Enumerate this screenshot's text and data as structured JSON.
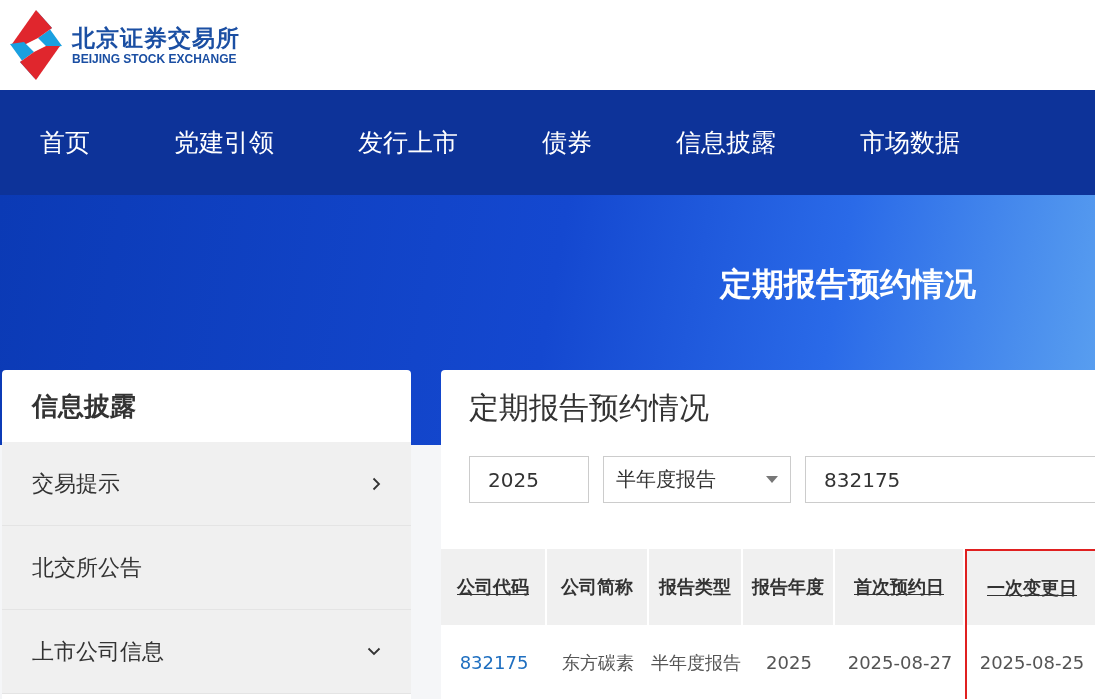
{
  "logo": {
    "name": "北京证券交易所",
    "name_en": "BEIJING STOCK EXCHANGE"
  },
  "nav": [
    {
      "label": "首页"
    },
    {
      "label": "党建引领"
    },
    {
      "label": "发行上市"
    },
    {
      "label": "债券"
    },
    {
      "label": "信息披露"
    },
    {
      "label": "市场数据"
    }
  ],
  "banner": {
    "title": "定期报告预约情况"
  },
  "sidebar": {
    "title": "信息披露",
    "items": [
      {
        "label": "交易提示",
        "expanded": false
      },
      {
        "label": "北交所公告"
      },
      {
        "label": "上市公司信息",
        "expanded": true
      }
    ]
  },
  "main": {
    "title": "定期报告预约情况",
    "filters": {
      "year": "2025",
      "report_type": "半年度报告",
      "code": "832175"
    },
    "table": {
      "columns": [
        {
          "label": "公司代码",
          "sortable": true,
          "highlighted": false
        },
        {
          "label": "公司简称",
          "sortable": false,
          "highlighted": false
        },
        {
          "label": "报告类型",
          "sortable": false,
          "highlighted": false
        },
        {
          "label": "报告年度",
          "sortable": false,
          "highlighted": false
        },
        {
          "label": "首次预约日",
          "sortable": true,
          "highlighted": false
        },
        {
          "label": "一次变更日",
          "sortable": true,
          "highlighted": true
        }
      ],
      "rows": [
        {
          "cells": [
            "832175",
            "东方碳素",
            "半年度报告",
            "2025",
            "2025-08-27",
            "2025-08-25"
          ]
        }
      ]
    }
  }
}
